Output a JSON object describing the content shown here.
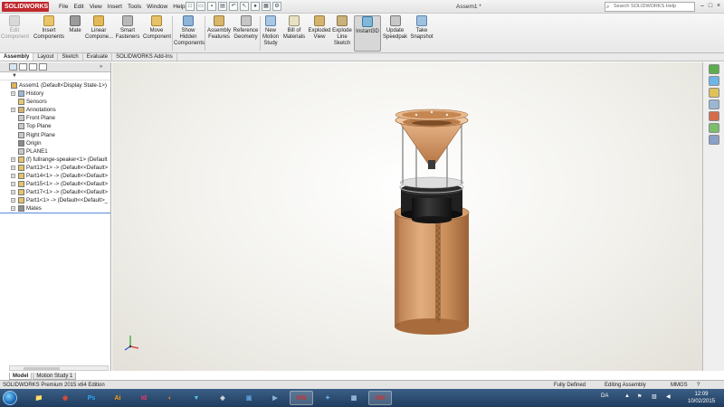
{
  "app": {
    "brand": "SOLIDWORKS",
    "document_title": "Assem1 *",
    "search_placeholder": "Search SOLIDWORKS Help",
    "menu": [
      "File",
      "Edit",
      "View",
      "Insert",
      "Tools",
      "Window",
      "Help"
    ]
  },
  "ribbon": {
    "buttons": [
      {
        "label": "Edit Component",
        "disabled": true
      },
      {
        "label": "Insert Components"
      },
      {
        "label": "Mate"
      },
      {
        "label": "Linear Compone..."
      },
      {
        "label": "Smart Fasteners"
      },
      {
        "label": "Move Component"
      },
      {
        "label": "Show Hidden Components"
      },
      {
        "label": "Assembly Features"
      },
      {
        "label": "Reference Geometry"
      },
      {
        "label": "New Motion Study"
      },
      {
        "label": "Bill of Materials"
      },
      {
        "label": "Exploded View"
      },
      {
        "label": "Explode Line Sketch"
      },
      {
        "label": "Instant3D",
        "active": true
      },
      {
        "label": "Update Speedpak"
      },
      {
        "label": "Take Snapshot"
      }
    ]
  },
  "command_tabs": [
    "Assembly",
    "Layout",
    "Sketch",
    "Evaluate",
    "SOLIDWORKS Add-Ins"
  ],
  "feature_tree": [
    {
      "label": "Assem1  (Default<Display State-1>)",
      "indent": 0
    },
    {
      "label": "History",
      "indent": 1,
      "expand": true
    },
    {
      "label": "Sensors",
      "indent": 1
    },
    {
      "label": "Annotations",
      "indent": 1,
      "expand": true
    },
    {
      "label": "Front Plane",
      "indent": 1
    },
    {
      "label": "Top Plane",
      "indent": 1
    },
    {
      "label": "Right Plane",
      "indent": 1
    },
    {
      "label": "Origin",
      "indent": 1
    },
    {
      "label": "PLANE1",
      "indent": 1
    },
    {
      "label": "(f) fullrange-speaker<1> (Default",
      "indent": 1,
      "expand": true
    },
    {
      "label": "Part13<1> -> (Default<<Default>",
      "indent": 1,
      "expand": true
    },
    {
      "label": "Part14<1> -> (Default<<Default>",
      "indent": 1,
      "expand": true
    },
    {
      "label": "Part15<1> -> (Default<<Default>",
      "indent": 1,
      "expand": true
    },
    {
      "label": "Part17<1> -> (Default<<Default>",
      "indent": 1,
      "expand": true
    },
    {
      "label": "Part1<1> -> (Default<<Default>_",
      "indent": 1,
      "expand": true
    },
    {
      "label": "Mates",
      "indent": 1,
      "expand": true,
      "selected": true
    }
  ],
  "bottom_tabs": [
    "Model",
    "Motion Study 1"
  ],
  "status": {
    "edition": "SOLIDWORKS Premium 2015 x64 Edition",
    "state": "Fully Defined",
    "mode": "Editing Assembly",
    "units": "MMGS"
  },
  "taskbar": {
    "apps": [
      {
        "name": "explorer",
        "glyph": "📁",
        "color": "#e8c15a"
      },
      {
        "name": "chrome",
        "glyph": "◉",
        "color": "#e04a3a"
      },
      {
        "name": "photoshop",
        "glyph": "Ps",
        "color": "#31a8ff"
      },
      {
        "name": "illustrator",
        "glyph": "Ai",
        "color": "#ff9a00"
      },
      {
        "name": "indesign",
        "glyph": "Id",
        "color": "#ff3366"
      },
      {
        "name": "blender",
        "glyph": "◐",
        "color": "#f5792a"
      },
      {
        "name": "vectorworks",
        "glyph": "▼",
        "color": "#4fc3e8"
      },
      {
        "name": "unity",
        "glyph": "◈",
        "color": "#dddddd"
      },
      {
        "name": "virtualbox",
        "glyph": "▣",
        "color": "#5b9bd5"
      },
      {
        "name": "media",
        "glyph": "▶",
        "color": "#8ab4d8"
      },
      {
        "name": "solidworks-1",
        "glyph": "SW",
        "color": "#d0312d"
      },
      {
        "name": "network",
        "glyph": "✦",
        "color": "#5fb3e6"
      },
      {
        "name": "desktop",
        "glyph": "▦",
        "color": "#9ac1e0"
      },
      {
        "name": "solidworks-2",
        "glyph": "SW",
        "color": "#d0312d"
      }
    ],
    "language": "DA",
    "time": "12:09",
    "date": "10/02/2015"
  },
  "colors": {
    "copper": "#c98e5a",
    "speaker_black": "#1b1b1b",
    "accent": "#c0272d"
  }
}
